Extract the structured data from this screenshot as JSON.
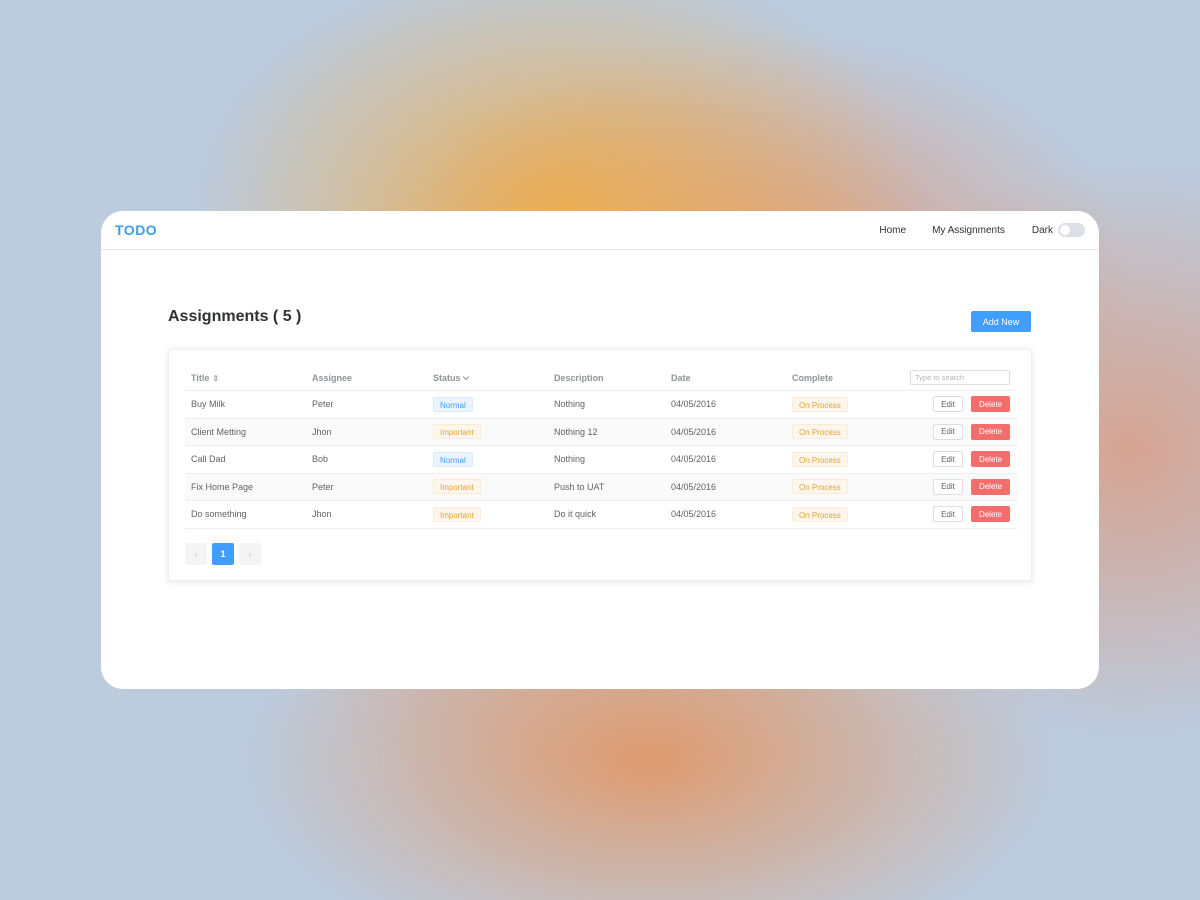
{
  "navbar": {
    "logo": "TODO",
    "links": {
      "home": "Home",
      "my_assignments": "My Assignments"
    },
    "dark_mode": {
      "label": "Dark",
      "enabled": false
    }
  },
  "page": {
    "title": "Assignments ( 5 )",
    "add_button": "Add New"
  },
  "table": {
    "columns": {
      "title": "Title",
      "assignee": "Assignee",
      "status": "Status",
      "description": "Description",
      "date": "Date",
      "complete": "Complete"
    },
    "search_placeholder": "Type to search",
    "edit_label": "Edit",
    "delete_label": "Delete",
    "rows": [
      {
        "title": "Buy Milk",
        "assignee": "Peter",
        "status": "Normal",
        "description": "Nothing",
        "date": "04/05/2016",
        "complete": "On Process"
      },
      {
        "title": "Client Metting",
        "assignee": "Jhon",
        "status": "Important",
        "description": "Nothing 12",
        "date": "04/05/2016",
        "complete": "On Process"
      },
      {
        "title": "Call Dad",
        "assignee": "Bob",
        "status": "Normal",
        "description": "Nothing",
        "date": "04/05/2016",
        "complete": "On Process"
      },
      {
        "title": "Fix Home Page",
        "assignee": "Peter",
        "status": "Important",
        "description": "Push to UAT",
        "date": "04/05/2016",
        "complete": "On Process"
      },
      {
        "title": "Do something",
        "assignee": "Jhon",
        "status": "Important",
        "description": "Do it quick",
        "date": "04/05/2016",
        "complete": "On Process"
      }
    ]
  },
  "pagination": {
    "prev": "‹",
    "current": "1",
    "next": "›"
  },
  "colors": {
    "brand": "#409eff",
    "danger": "#f56c6c",
    "warning": "#e6a23c"
  },
  "icons": {
    "sort": "sort-icon",
    "status_filter": "chevron-down-icon"
  }
}
